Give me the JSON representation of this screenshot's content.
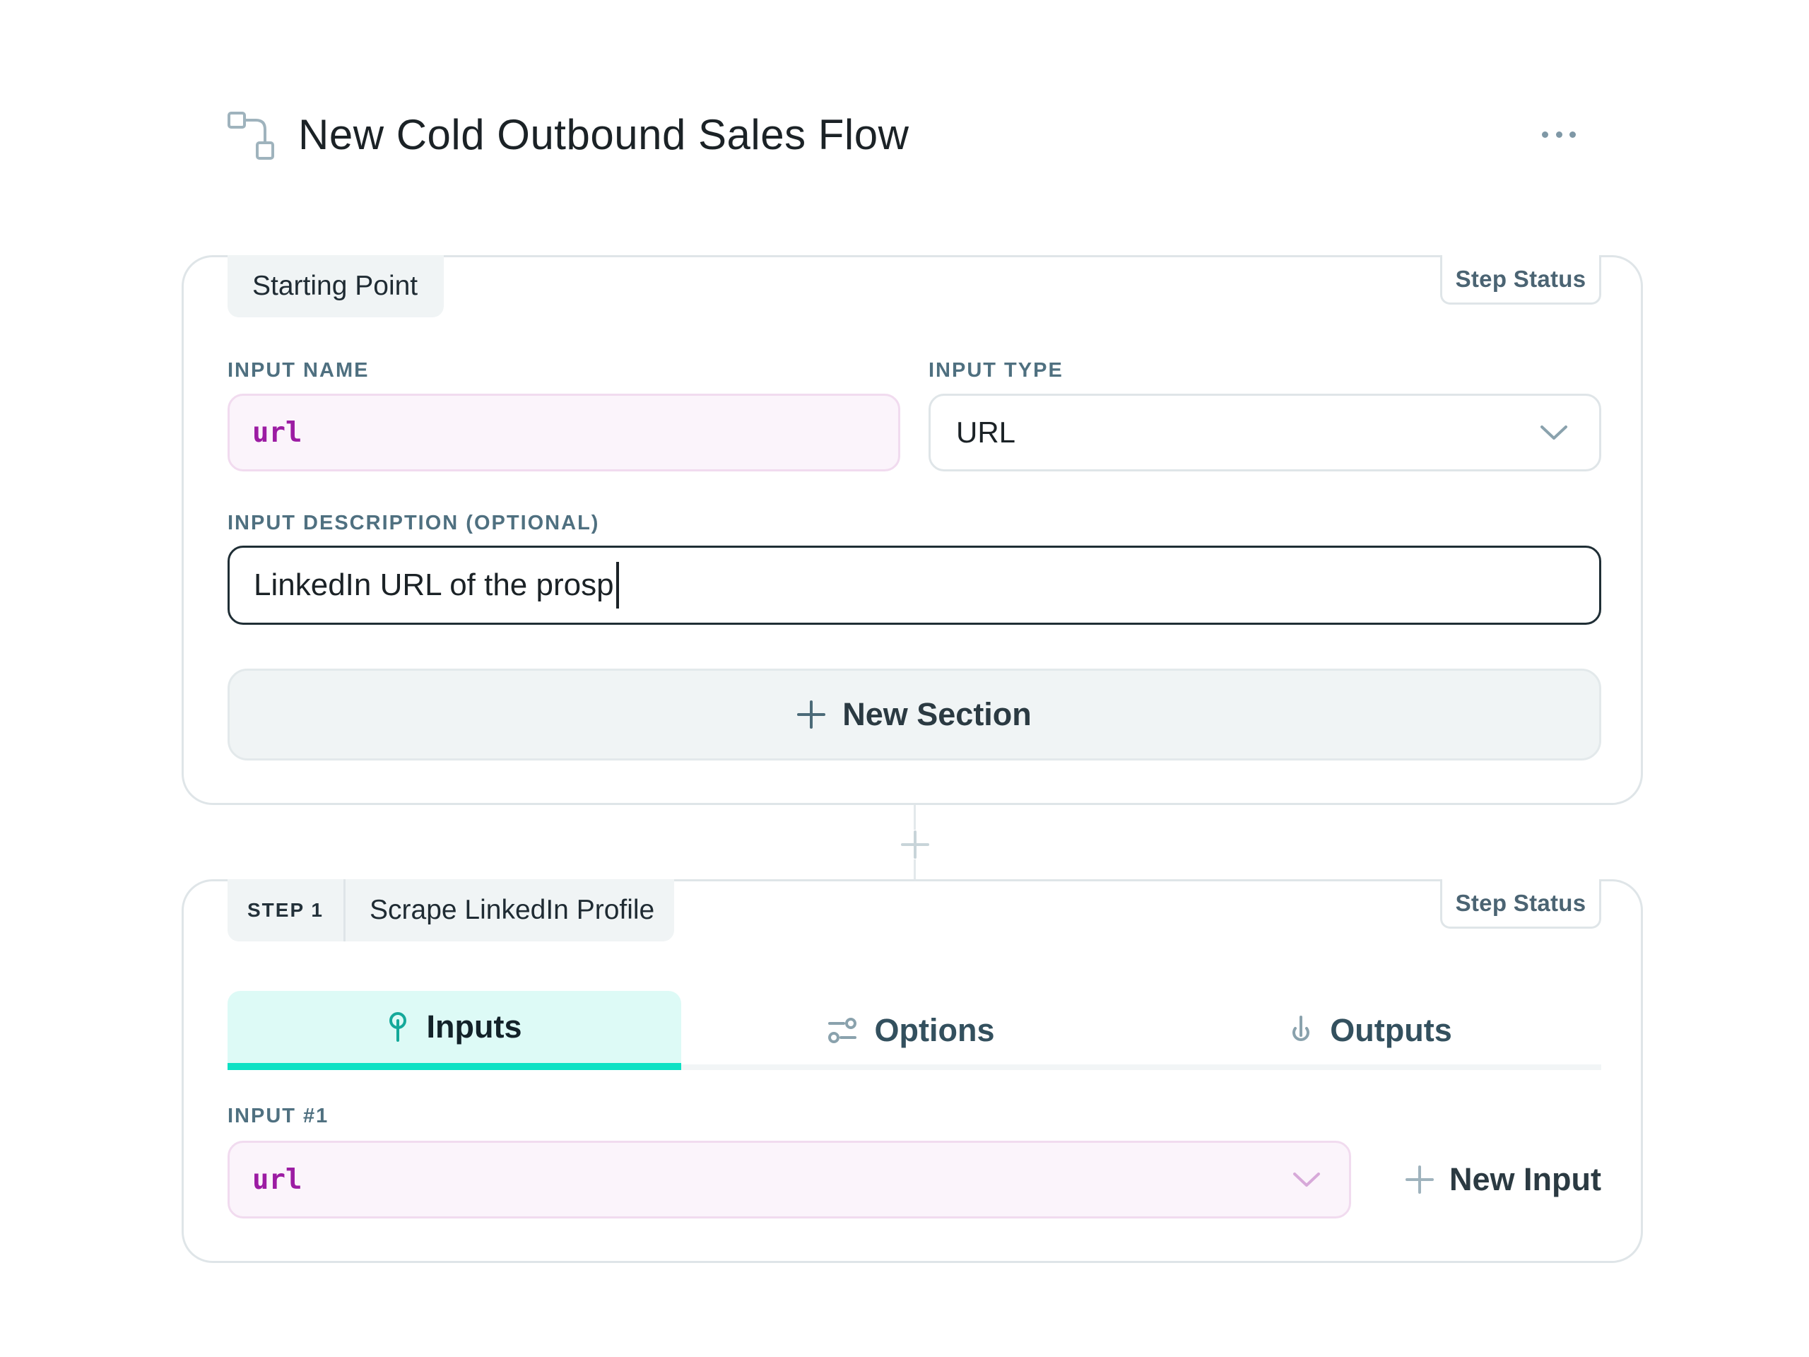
{
  "header": {
    "title": "New Cold Outbound Sales Flow"
  },
  "starting_point": {
    "chip_label": "Starting Point",
    "status_label": "Step Status",
    "input_name_label": "INPUT NAME",
    "input_name_value": "url",
    "input_type_label": "INPUT TYPE",
    "input_type_value": "URL",
    "description_label": "INPUT DESCRIPTION (OPTIONAL)",
    "description_value": "LinkedIn URL of the prosp",
    "new_section_label": "New Section"
  },
  "step1": {
    "step_number": "STEP 1",
    "title": "Scrape LinkedIn Profile",
    "status_label": "Step Status",
    "tabs": [
      {
        "label": "Inputs",
        "icon": "pin-icon",
        "active": true
      },
      {
        "label": "Options",
        "icon": "sliders-icon",
        "active": false
      },
      {
        "label": "Outputs",
        "icon": "output-icon",
        "active": false
      }
    ],
    "input1_label": "INPUT #1",
    "input1_value": "url",
    "new_input_label": "New Input"
  },
  "colors": {
    "accent": "#0ee1c4",
    "active_tab_bg": "#ddfaf6",
    "variable_text": "#9c1ca3",
    "variable_bg": "#fbf4fb"
  }
}
